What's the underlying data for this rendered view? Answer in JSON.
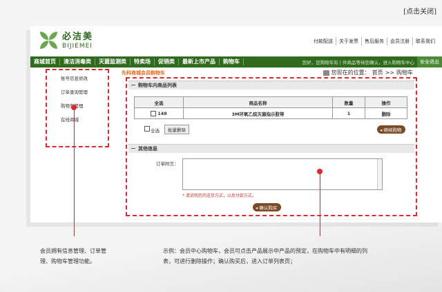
{
  "close_label": "[点击关闭]",
  "logo": {
    "cn": "必洁美",
    "en": "BIJIEMEI"
  },
  "top_links": [
    "付款配送",
    "关于发票",
    "售后服务",
    "会员注册",
    "联系我们"
  ],
  "nav": {
    "items": [
      "商城首页",
      "清洁消毒类",
      "灭菌监测类",
      "特卖场",
      "促销类",
      "最新上市产品",
      "购物车"
    ],
    "notice": "您好，您购物车有 | 件商品等待您确认，进入购物车中心",
    "safe": "安全退出"
  },
  "left_menu": [
    "账号信息修改",
    "订单查询管理",
    "购物车管理",
    "在线商城"
  ],
  "page_title": "先科商城会员购物车",
  "breadcrumb": {
    "prefix": "您现在的位置：",
    "home": "首页",
    "sep": ">>",
    "current": "购物车"
  },
  "cart_section": {
    "title": "购物车内商品列表",
    "headers": [
      "全选",
      "商品名称",
      "数量",
      "操作"
    ],
    "rows": [
      {
        "id": "148",
        "name": "3M环氧乙烷灭菌指示胶带",
        "qty": "1",
        "action": "删除"
      }
    ],
    "select_all": "全选",
    "batch_delete": "批量删除",
    "continue": "继续购物"
  },
  "other_section": {
    "title": "其他信息",
    "remark_label": "订单附言：",
    "remark_value": "",
    "hint": "* 请说明您的送货方式，以及付款方式。",
    "confirm": "确认购买"
  },
  "captions": {
    "left": [
      "会员拥有信息管理、订单管",
      "理、购物车管理功能。"
    ],
    "right": [
      "示例：会员中心购物车，会员可点击产品展示中产品的预定，在购物车中有明细的列",
      "表，可进行删除操作；确认购买后，进入订单列表页；"
    ]
  },
  "colors": {
    "nav_green": "#2f6b1c",
    "highlight_red": "#e8242b",
    "accent_orange": "#e86a10"
  }
}
